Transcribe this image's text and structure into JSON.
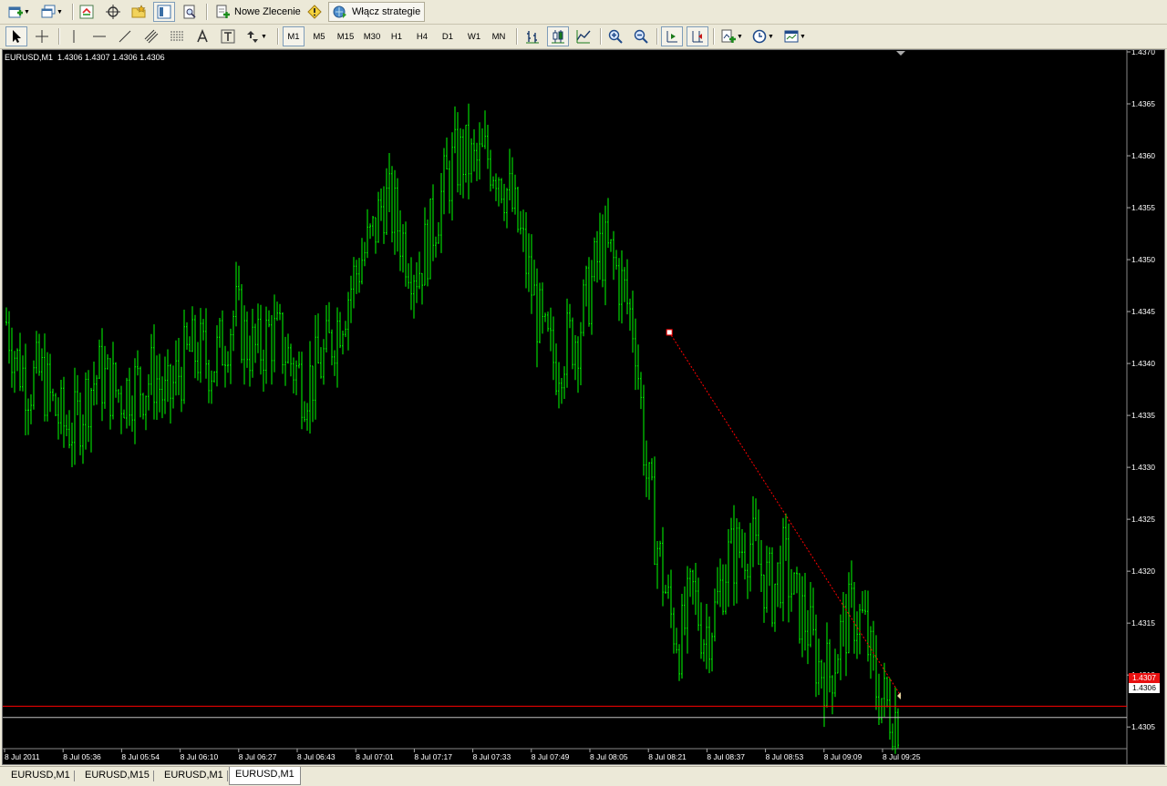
{
  "toolbar1": {
    "new_order_label": "Nowe Zlecenie",
    "strategies_label": "Włącz strategie"
  },
  "toolbar2": {
    "timeframes": [
      "M1",
      "M5",
      "M15",
      "M30",
      "H1",
      "H4",
      "D1",
      "W1",
      "MN"
    ],
    "active_timeframe": "M1"
  },
  "chart": {
    "title": "EURUSD,M1  1.4306 1.4307 1.4306 1.4306",
    "bid_label": "1.4307",
    "ask_label": "1.4306",
    "colors": {
      "background": "#000000",
      "bars": "#00ff00",
      "bid_line": "#ff0000",
      "ask_line": "#c0c0c0",
      "trendline": "#ff0000"
    }
  },
  "chart_data": {
    "type": "ohlc",
    "symbol": "EURUSD",
    "timeframe": "M1",
    "ylim": [
      1.4303,
      1.437
    ],
    "y_ticks": [
      "1.4370",
      "1.4365",
      "1.4360",
      "1.4355",
      "1.4350",
      "1.4345",
      "1.4340",
      "1.4335",
      "1.4330",
      "1.4325",
      "1.4320",
      "1.4315",
      "1.4310",
      "1.4305"
    ],
    "x_ticks": [
      "8 Jul 2011",
      "8 Jul 05:36",
      "8 Jul 05:54",
      "8 Jul 06:10",
      "8 Jul 06:27",
      "8 Jul 06:43",
      "8 Jul 07:01",
      "8 Jul 07:17",
      "8 Jul 07:33",
      "8 Jul 07:49",
      "8 Jul 08:05",
      "8 Jul 08:21",
      "8 Jul 08:37",
      "8 Jul 08:53",
      "8 Jul 09:09",
      "8 Jul 09:25"
    ],
    "close_path": [
      1.4344,
      1.434,
      1.4338,
      1.4339,
      1.4336,
      1.4334,
      1.4334,
      1.4337,
      1.4339,
      1.4338,
      1.4337,
      1.4338,
      1.4338,
      1.4339,
      1.4336,
      1.4339,
      1.4341,
      1.4341,
      1.434,
      1.4342,
      1.4345,
      1.4342,
      1.4341,
      1.4343,
      1.4342,
      1.434,
      1.4338,
      1.4339,
      1.4341,
      1.4344,
      1.4347,
      1.435,
      1.4352,
      1.4356,
      1.4354,
      1.4351,
      1.4349,
      1.4352,
      1.4356,
      1.4359,
      1.436,
      1.4359,
      1.436,
      1.4359,
      1.4356,
      1.4352,
      1.4347,
      1.4342,
      1.434,
      1.4342,
      1.4343,
      1.4347,
      1.4351,
      1.435,
      1.4347,
      1.4343,
      1.4329,
      1.4322,
      1.4316,
      1.4313,
      1.4318,
      1.4314,
      1.4316,
      1.4321,
      1.4322,
      1.4323,
      1.432,
      1.4318,
      1.4321,
      1.4317,
      1.4315,
      1.4311,
      1.431,
      1.4314,
      1.4316,
      1.4315,
      1.4309,
      1.4307,
      1.4306
    ],
    "current_bid": 1.4307,
    "current_ask": 1.4306,
    "trendline": {
      "from": {
        "time": "8 Jul 08:21",
        "price": 1.4343
      },
      "to": {
        "time": "8 Jul 09:25",
        "price": 1.4308
      }
    }
  },
  "tabs": [
    "EURUSD,M1",
    "EURUSD,M15",
    "EURUSD,M1",
    "EURUSD,M1"
  ],
  "active_tab": 3
}
